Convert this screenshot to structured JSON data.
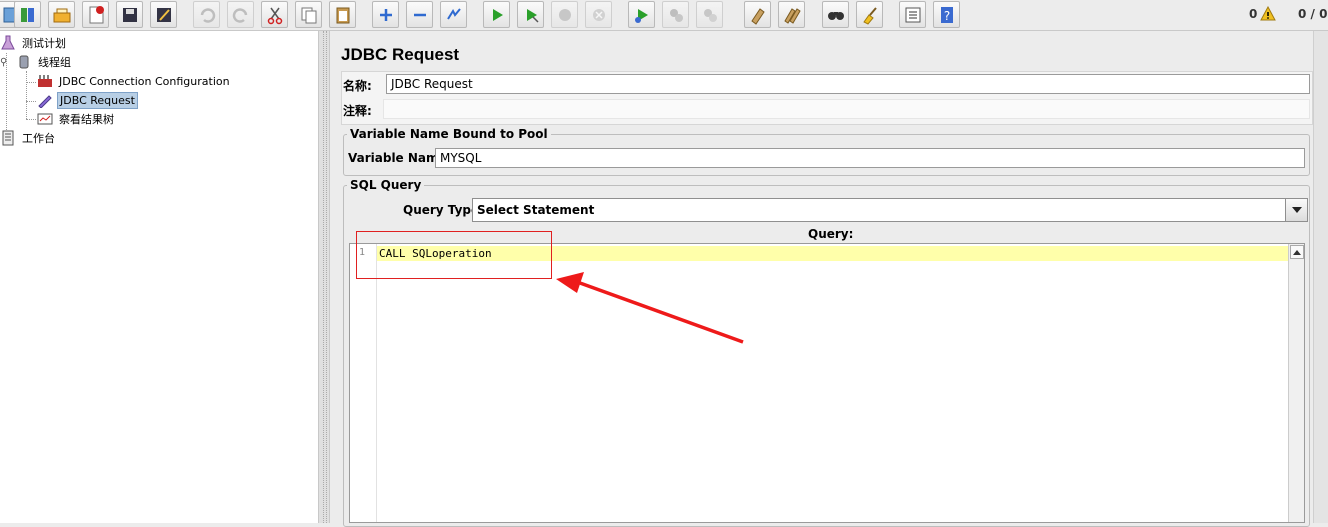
{
  "toolbar": {
    "icons": [
      "template-icon",
      "open-icon",
      "close-icon",
      "save-icon",
      "save-as-icon",
      "undo-icon",
      "redo-icon",
      "cut-icon",
      "copy-icon",
      "paste-icon",
      "expand-icon",
      "collapse-icon",
      "toggle-icon",
      "start-icon",
      "start-no-pause-icon",
      "stop-icon",
      "shutdown-icon",
      "remote-start-icon",
      "remote-stop-icon",
      "remote-shutdown-icon",
      "clear-icon",
      "clear-all-icon",
      "search-icon",
      "reset-search-icon",
      "function-helper-icon",
      "help-icon"
    ],
    "warning_count": "0",
    "thread_count": "0 / 0"
  },
  "tree": {
    "nodes": [
      {
        "label": "测试计划",
        "icon": "test-plan-icon"
      },
      {
        "label": "线程组",
        "icon": "thread-group-icon"
      },
      {
        "label": "JDBC Connection Configuration",
        "icon": "config-element-icon"
      },
      {
        "label": "JDBC Request",
        "icon": "sampler-icon",
        "selected": true
      },
      {
        "label": "察看结果树",
        "icon": "listener-icon"
      },
      {
        "label": "工作台",
        "icon": "workbench-icon"
      }
    ]
  },
  "main": {
    "title": "JDBC Request",
    "name_label": "名称:",
    "name_value": "JDBC Request",
    "comment_label": "注释:",
    "comment_value": "",
    "pool_group_title": "Variable Name Bound to Pool",
    "variable_name_label": "Variable Name:",
    "variable_name_value": "MYSQL",
    "sql_group_title": "SQL Query",
    "query_type_label": "Query Type:",
    "query_type_value": "Select Statement",
    "query_label": "Query:",
    "query_line_number": "1",
    "query_text": "CALL SQLoperation"
  },
  "colors": {
    "annotation": "#e02020",
    "current_line_highlight": "#ffffaa",
    "selection": "#b8cfe5"
  }
}
